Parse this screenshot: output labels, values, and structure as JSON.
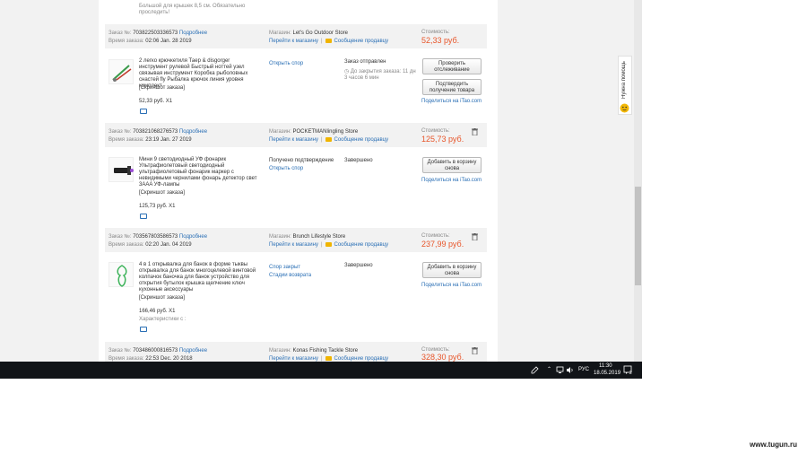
{
  "common": {
    "order_no_label": "Заказ №:",
    "details_link": "Подробнее",
    "order_time_label": "Время заказа:",
    "store_label": "Магазин:",
    "goto_store": "Перейти к магазину",
    "separator": "|",
    "message_seller": "Сообщение продавцу",
    "cost_label": "Стоимость:",
    "share_prefix": "Поделиться на",
    "share_site": "iTao.com",
    "screenshot_link": "[Скриншот заказа]"
  },
  "top_fragment": {
    "text": "Большой для крышек 8,5 см. Обязательно проследить!"
  },
  "orders": [
    {
      "number": "703822503336573",
      "time": "02:06 Jan. 28 2019",
      "store": "Let's Go Outdoor Store",
      "cost": "52,33 руб.",
      "product_title": "2 легко крючкетиля Таер & disgorger инструмент рулевой Быстрый ноттей узел связывая инструмент Коробка рыболовных снастей fly Рыбалка крючок линия уровня комплект",
      "price_qty": "52,33 руб. X1",
      "action_link": "Открыть спор",
      "status": "Заказ отправлен",
      "timer_text": "До закрытия заказа: 11 дн 3 часов 6 мин",
      "buttons": [
        "Проверить отслеживание",
        "Подтвердить получение товара"
      ]
    },
    {
      "number": "703821068276573",
      "time": "23:19 Jan. 27 2019",
      "store": "POCKETMANlingling Store",
      "cost": "125,73 руб.",
      "product_title": "Мини 9 светодиодный УФ фонарик Ультрафиолетовый светодиодный ультрафиолетовый фонарик маркер с невидимыми чернилами фонарь детектор свет 3AAA УФ-лампы",
      "price_qty": "125,73 руб. X1",
      "action_title": "Получено подтверждение",
      "action_link": "Открыть спор",
      "status": "Завершено",
      "buttons": [
        "Добавить в корзину снова"
      ]
    },
    {
      "number": "703567803586573",
      "time": "02:20 Jan. 04 2019",
      "store": "Brunch Lifestyle Store",
      "cost": "237,99 руб.",
      "product_title": "4 в 1 открывалка для банок в форме тыквы открывалка для банок многоцелевой винтовой колпачок баночка для банок устройство для открытия бутылок крышка щелчение ключ кухонные аксессуары",
      "price_qty": "166,46 руб. X1",
      "characteristics": "Характеристики с :",
      "action_link": "Спор закрыт",
      "action_link2": "Стадии возврата",
      "status": "Завершено",
      "buttons": [
        "Добавить в корзину снова"
      ]
    },
    {
      "number": "703486000816573",
      "time": "22:53 Dec. 20 2018",
      "store": "Konas Fishing Tackle Store",
      "cost": "328,30 руб."
    }
  ],
  "help_tab": {
    "label": "Нужна помощь"
  },
  "taskbar": {
    "language": "РУС",
    "time": "11:30",
    "date": "18.05.2019",
    "notifications": "2"
  },
  "watermark": "www.tugun.ru"
}
